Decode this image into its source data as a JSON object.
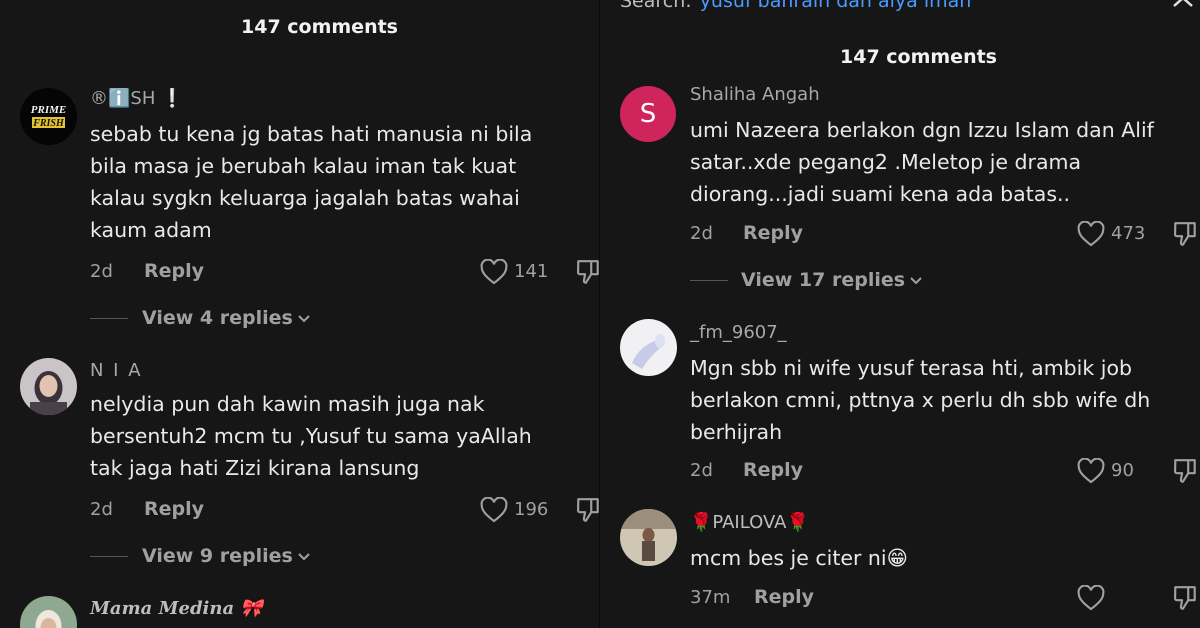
{
  "left": {
    "header_title": "147 comments",
    "comments": [
      {
        "username": "®ℹ️SH ❕",
        "avatar": "prime-frish-logo",
        "lines": [
          "sebab tu kena jg batas hati manusia ni bila",
          "bila masa je berubah kalau iman tak kuat",
          "kalau sygkn keluarga jagalah batas wahai",
          "kaum adam"
        ],
        "time": "2d",
        "reply": "Reply",
        "likes": "141",
        "view_replies": "View 4 replies"
      },
      {
        "username": "N I A",
        "avatar": "person-photo",
        "lines": [
          "nelydia pun dah kawin masih juga nak",
          "bersentuh2 mcm tu ,Yusuf tu sama yaAllah",
          "tak jaga hati Zizi kirana lansung"
        ],
        "time": "2d",
        "reply": "Reply",
        "likes": "196",
        "view_replies": "View 9 replies"
      },
      {
        "username": "Mama Medina 🎀",
        "avatar": "person-photo"
      }
    ]
  },
  "right": {
    "search_label": "Search:",
    "search_query": "yusuf bahrain dan aiya iman",
    "header_title": "147 comments",
    "comments": [
      {
        "username": "Shaliha Angah",
        "avatar_letter": "S",
        "avatar_color": "#d0245c",
        "lines": [
          "umi Nazeera berlakon dgn Izzu Islam dan Alif",
          "satar..xde pegang2 .Meletop je drama",
          "diorang...jadi suami kena ada batas.."
        ],
        "time": "2d",
        "reply": "Reply",
        "likes": "473",
        "view_replies": "View 17 replies"
      },
      {
        "username": "_fm_9607_",
        "avatar": "hand-photo",
        "lines": [
          "Mgn sbb ni wife yusuf terasa hti, ambik job",
          "berlakon cmni, pttnya x perlu dh sbb wife dh",
          "berhijrah"
        ],
        "time": "2d",
        "reply": "Reply",
        "likes": "90"
      },
      {
        "username": "🌹PAILOVA🌹",
        "avatar": "person-photo",
        "lines": [
          "mcm bes je citer ni😁"
        ],
        "time": "37m",
        "reply": "Reply"
      }
    ]
  },
  "colors": {
    "background": "#161616",
    "text": "#e9e9e9",
    "muted": "#a0a0a0",
    "search_accent": "#4b9bff",
    "avatar_s": "#d0245c"
  }
}
